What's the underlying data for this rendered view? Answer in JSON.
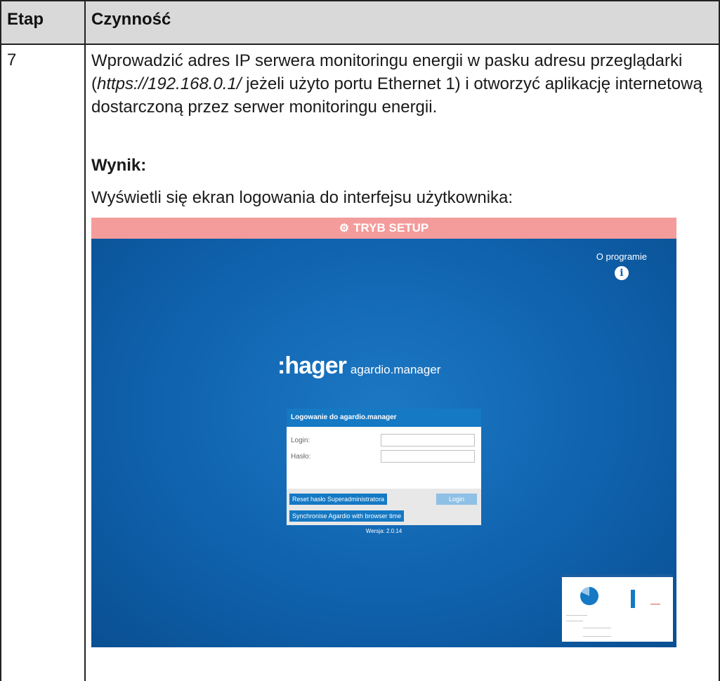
{
  "table": {
    "col_step": "Etap",
    "col_action": "Czynność",
    "step_number": "7"
  },
  "instruction": {
    "part1": "Wprowadzić adres IP serwera monitoringu energii w pasku adresu przeglądarki (",
    "url": "https://192.168.0.1/",
    "part2": " jeżeli użyto portu Ethernet 1) i otworzyć aplikację internetową dostarczoną przez serwer monitoringu energii."
  },
  "result": {
    "heading": "Wynik:",
    "text": "Wyświetli się ekran logowania do interfejsu użytkownika:"
  },
  "screenshot": {
    "setup_bar": "TRYB SETUP",
    "about_label": "O programie",
    "logo_brand": ":hager",
    "logo_product": "agardio.manager",
    "login_title": "Logowanie do agardio.manager",
    "login_label": "Login:",
    "password_label": "Hasło:",
    "reset_button": "Reset hasło Superadministratora",
    "login_button": "Login",
    "sync_button": "Synchronise Agardio with browser time",
    "version": "Wersja: 2.0.14",
    "colors": {
      "setup_bar": "#f49b9b",
      "background": "#0f62ad",
      "accent": "#1579c4"
    },
    "icons": [
      "gears-icon",
      "info-icon"
    ]
  }
}
